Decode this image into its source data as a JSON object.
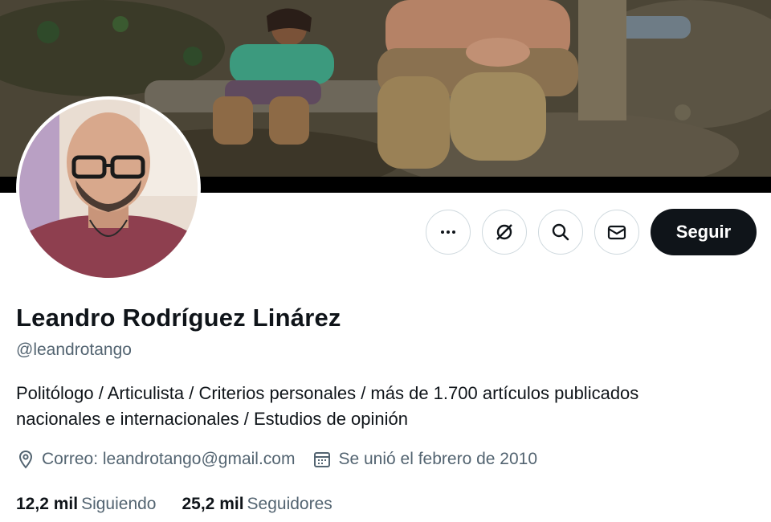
{
  "profile": {
    "name": "Leandro Rodríguez Linárez",
    "handle": "@leandrotango",
    "bio_line1": "Politólogo / Articulista / Criterios personales / más de 1.700 artículos publicados",
    "bio_line2": "nacionales e internacionales / Estudios de opinión",
    "location": "Correo: leandrotango@gmail.com",
    "joined": "Se unió el febrero de 2010"
  },
  "stats": {
    "following_count": "12,2 mil",
    "following_label": "Siguiendo",
    "followers_count": "25,2 mil",
    "followers_label": "Seguidores"
  },
  "actions": {
    "follow_label": "Seguir",
    "more_icon": "more-icon",
    "grok_icon": "grok-icon",
    "search_icon": "search-icon",
    "message_icon": "mail-icon"
  },
  "colors": {
    "accent_dark": "#0f1419",
    "secondary_text": "#536471",
    "border": "#cfd9de"
  }
}
